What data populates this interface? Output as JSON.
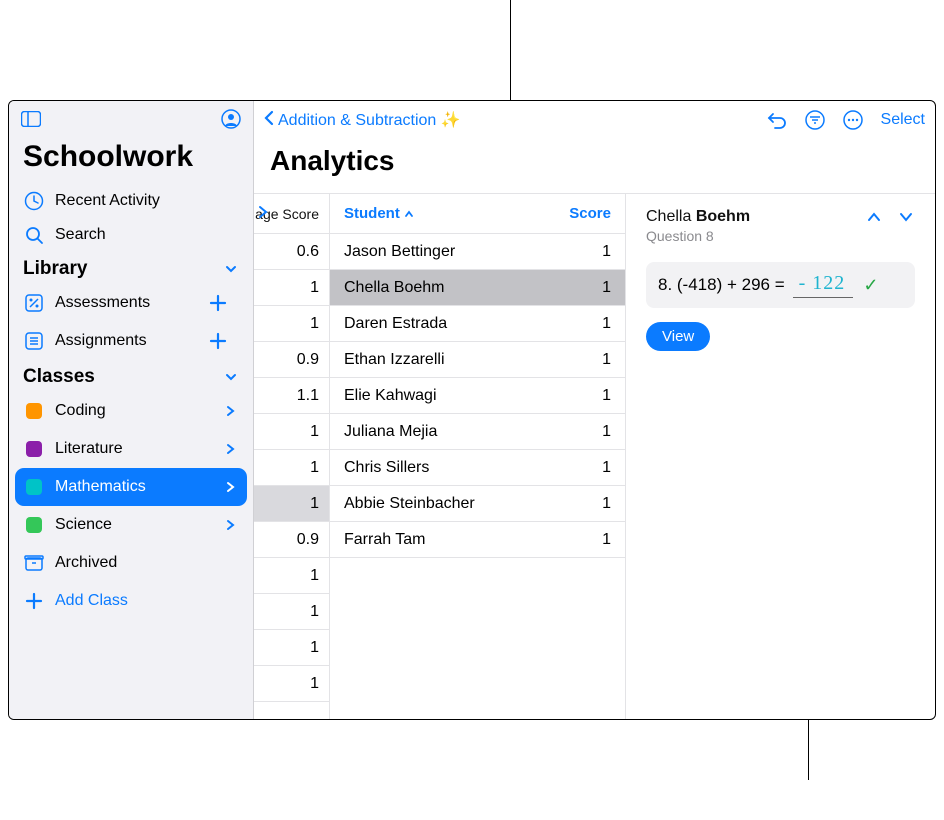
{
  "sidebar": {
    "appTitle": "Schoolwork",
    "recent": "Recent Activity",
    "search": "Search",
    "libraryHeader": "Library",
    "assessments": "Assessments",
    "assignments": "Assignments",
    "classesHeader": "Classes",
    "classes": [
      {
        "label": "Coding",
        "iconColor": "#ff9500",
        "active": false
      },
      {
        "label": "Literature",
        "iconColor": "#8b1fa9",
        "active": false
      },
      {
        "label": "Mathematics",
        "iconColor": "#00c3c7",
        "active": true
      },
      {
        "label": "Science",
        "iconColor": "#34c759",
        "active": false
      }
    ],
    "archived": "Archived",
    "addClass": "Add Class"
  },
  "topbar": {
    "backLabel": "Addition & Subtraction ✨",
    "select": "Select"
  },
  "pageTitle": "Analytics",
  "scoreCol": {
    "header": "age Score",
    "values": [
      "0.6",
      "1",
      "1",
      "0.9",
      "1.1",
      "1",
      "1",
      "1",
      "0.9",
      "1",
      "1",
      "1",
      "1"
    ],
    "selectedIndex": 7
  },
  "students": {
    "headerStudent": "Student",
    "headerScore": "Score",
    "rows": [
      {
        "name": "Jason Bettinger",
        "score": "1"
      },
      {
        "name": "Chella Boehm",
        "score": "1"
      },
      {
        "name": "Daren Estrada",
        "score": "1"
      },
      {
        "name": "Ethan Izzarelli",
        "score": "1"
      },
      {
        "name": "Elie Kahwagi",
        "score": "1"
      },
      {
        "name": "Juliana Mejia",
        "score": "1"
      },
      {
        "name": "Chris Sillers",
        "score": "1"
      },
      {
        "name": "Abbie Steinbacher",
        "score": "1"
      },
      {
        "name": "Farrah Tam",
        "score": "1"
      }
    ],
    "selectedIndex": 1
  },
  "detail": {
    "nameFirst": "Chella",
    "nameLast": "Boehm",
    "question": "Question 8",
    "prompt": "8.  (-418) + 296 =",
    "answer": "- 122",
    "viewLabel": "View"
  }
}
